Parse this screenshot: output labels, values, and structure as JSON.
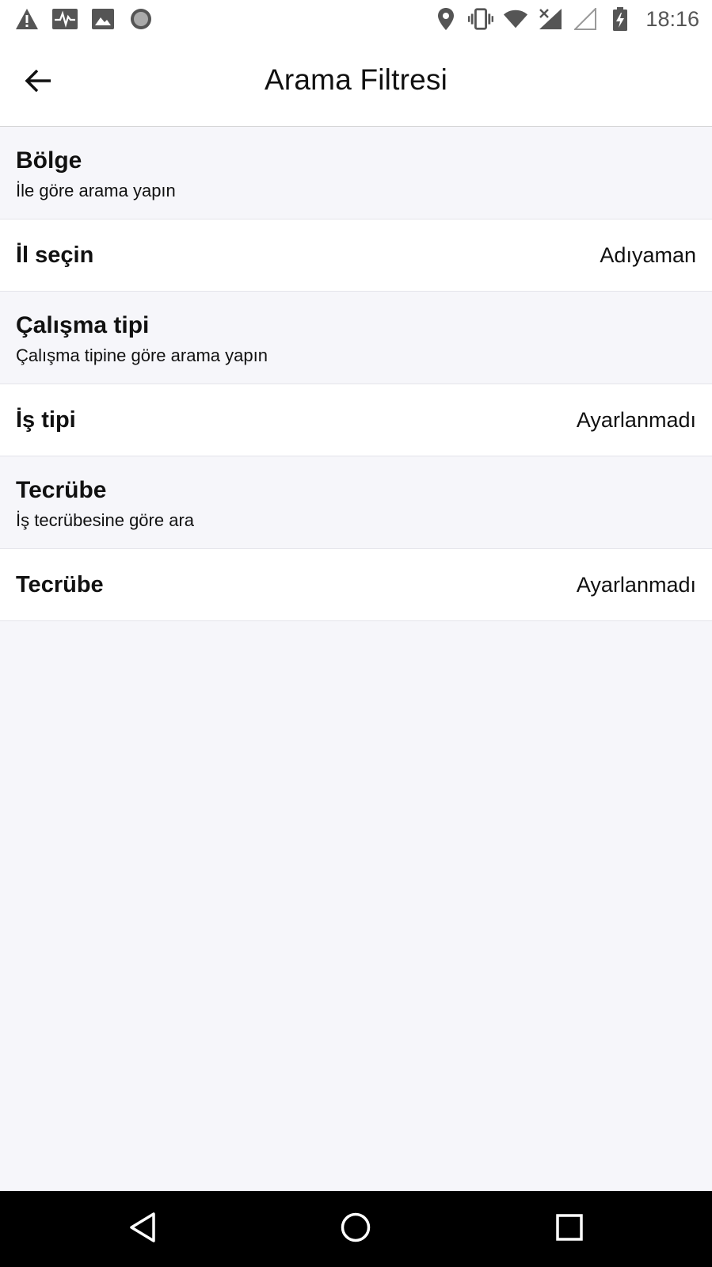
{
  "status_bar": {
    "time": "18:16",
    "left_icons": [
      "warning-icon",
      "activity-icon",
      "image-icon",
      "record-icon"
    ],
    "right_icons": [
      "location-icon",
      "vibrate-icon",
      "wifi-icon",
      "signal-off-icon",
      "signal-empty-icon",
      "battery-charging-icon"
    ]
  },
  "app_bar": {
    "title": "Arama Filtresi",
    "back_icon": "arrow-left-icon"
  },
  "sections": [
    {
      "title": "Bölge",
      "subtitle": "İle göre arama yapın",
      "row": {
        "label": "İl seçin",
        "value": "Adıyaman"
      }
    },
    {
      "title": "Çalışma tipi",
      "subtitle": "Çalışma tipine göre arama yapın",
      "row": {
        "label": "İş tipi",
        "value": "Ayarlanmadı"
      }
    },
    {
      "title": "Tecrübe",
      "subtitle": "İş tecrübesine göre ara",
      "row": {
        "label": "Tecrübe",
        "value": "Ayarlanmadı"
      }
    }
  ],
  "nav_bar": {
    "buttons": [
      "back-triangle-icon",
      "home-circle-icon",
      "recents-square-icon"
    ]
  },
  "colors": {
    "page_background": "#f6f6fa",
    "surface": "#ffffff",
    "text": "#111111",
    "status_icon": "#555555",
    "nav_bar": "#000000"
  }
}
